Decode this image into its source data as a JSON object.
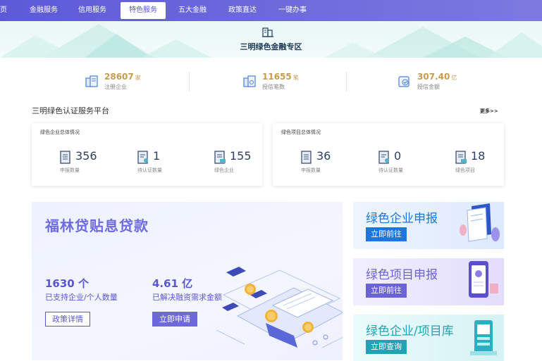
{
  "nav": {
    "items": [
      {
        "label": "页"
      },
      {
        "label": "金融服务"
      },
      {
        "label": "信用服务"
      },
      {
        "label": "特色服务"
      },
      {
        "label": "五大金融"
      },
      {
        "label": "政策直达"
      },
      {
        "label": "一键办事"
      }
    ],
    "active_index": 3
  },
  "hero": {
    "icon": "building-icon",
    "title": "三明绿色金融专区"
  },
  "stats": [
    {
      "value": "28607",
      "unit": "家",
      "label": "注册企业",
      "icon": "company-icon"
    },
    {
      "value": "11655",
      "unit": "笔",
      "label": "授信笔数",
      "icon": "credit-count-icon"
    },
    {
      "value": "307.40",
      "unit": "亿",
      "label": "授信金额",
      "icon": "credit-amount-icon"
    }
  ],
  "platform": {
    "title": "三明绿色认证服务平台",
    "more": "更多>>",
    "cards": [
      {
        "title": "绿色企业总体情况",
        "metrics": [
          {
            "value": "356",
            "label": "申报数量"
          },
          {
            "value": "1",
            "label": "待认证数量"
          },
          {
            "value": "155",
            "label": "绿色企业"
          }
        ]
      },
      {
        "title": "绿色项目总体情况",
        "metrics": [
          {
            "value": "36",
            "label": "申报数量"
          },
          {
            "value": "0",
            "label": "待认证数量"
          },
          {
            "value": "18",
            "label": "绿色项目"
          }
        ]
      }
    ]
  },
  "loan": {
    "title": "福林贷贴息贷款",
    "stat1": {
      "value": "1630 个",
      "label": "已支持企业/个人数量"
    },
    "stat2": {
      "value": "4.61 亿",
      "label": "已解决融资需求金额"
    },
    "detail_button": "政策详情",
    "apply_button": "立即申请"
  },
  "side_banners": [
    {
      "title": "绿色企业申报",
      "button": "立即前往",
      "color": "#1f75e0"
    },
    {
      "title": "绿色项目申报",
      "button": "立即前往",
      "color": "#6a63d6"
    },
    {
      "title": "绿色企业/项目库",
      "button": "立即查询",
      "color": "#1fa3b5"
    }
  ],
  "colors": {
    "nav_bg": "#5d5ad8",
    "accent_gold": "#c89b4c",
    "loan_purple": "#5a56cf"
  }
}
